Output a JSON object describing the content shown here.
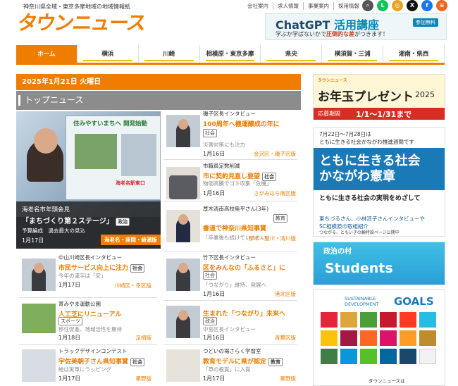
{
  "header": {
    "tagline": "神奈川県全域・東京多摩地域の地域情報紙",
    "logo": "タウンニュース",
    "logo_mark": "®",
    "top_links": [
      "会社案内",
      "求人情報",
      "事業案内",
      "採用情報"
    ]
  },
  "top_ad": {
    "title_a": "ChatGPT",
    "title_b": "活用講座",
    "badge": "参加無料",
    "subtitle_a": "学ぶか学ばないかで",
    "subtitle_b": "圧倒的な差",
    "subtitle_c": "がつきます！"
  },
  "nav": {
    "items": [
      "ホーム",
      "横浜",
      "川崎",
      "相模原・東京多摩",
      "県央",
      "横須賀・三浦",
      "湘南・県西"
    ]
  },
  "date_bar": "2025年1月21日 火曜日",
  "section_title": "トップニュース",
  "hero": {
    "board_title": "住みやすいまちへ 開発始動",
    "board_note": "海老名駅東口",
    "category": "海老名市年頭会見",
    "title": "「まちづくり第２ステージ」",
    "tag": "政治",
    "summary": "予算編成　過去最大の見込",
    "date": "1月17日",
    "area": "海老名・座間・綾瀬版"
  },
  "news_items": [
    {
      "category": "磯子区長インタビュー",
      "title": "100周年へ機運醸成の年に",
      "tag": "社会",
      "summary": "災害対策にも注力",
      "date": "1月16日",
      "area": "金沢区・磯子区版"
    },
    {
      "category": "市職員定数削減",
      "title": "市に契約見直し要望",
      "tag": "社会",
      "summary": "物価高騰でゴミ収集「危機」",
      "date": "1月16日",
      "area": "さがみはら南区版"
    },
    {
      "category": "厚木清南高校奥平さん(3年)",
      "title": "書道で神奈川県知事賞",
      "tag": "教育",
      "summary": "「卒業後も続けていきたい」",
      "date": "1月16日",
      "area": "厚木・愛川・清川版"
    },
    {
      "category": "中山川崎区長インタビュー",
      "title": "市民サービス向上に注力",
      "tag": "社会",
      "summary": "今年の漢字は「安」",
      "date": "1月17日",
      "area": "川崎区・幸区版"
    },
    {
      "category": "竹下区長インタビュー",
      "title": "区をみんなの「ふるさと」に",
      "tag": "社会",
      "summary": "「つながり」維持、発展へ",
      "date": "1月16日",
      "area": "港北区版"
    },
    {
      "category": "寄みやま運動公園",
      "title": "人工芝にリニューアル",
      "tag": "スポーツ",
      "summary": "移住促進、地域活性を期待",
      "date": "1月18日",
      "area": "足柄版"
    },
    {
      "category": "",
      "title": "生まれた「つながり」未来へ",
      "tag": "政治",
      "summary": "中島区長インタビュー",
      "date": "1月16日",
      "area": "青葉区版"
    },
    {
      "category": "トラックデザインコンテスト",
      "title": "宇佐美朝子さん県知事賞",
      "tag": "社会",
      "summary": "絵は実車にラッピング",
      "date": "1月17日",
      "area": "秦野版"
    },
    {
      "category": "つどいの場さらく学習室",
      "title": "教育モデルに県が認定",
      "tag": "教育",
      "summary": "「草の根賞」に入賞",
      "date": "1月17日",
      "area": "秦野版"
    }
  ],
  "sidebar": {
    "ad1": {
      "mini": "タウンニュース",
      "title": "お年玉プレゼント",
      "year": "2025",
      "label": "応募期間",
      "period": "1/1〜1/31まで"
    },
    "ad2": {
      "top_a": "7月22日〜7月28日は",
      "top_b": "ともに生きる社会かながわ推進週間です",
      "title_a": "ともに生きる社会",
      "title_b": "かながわ憲章",
      "mid_a": "ともに生きる社会の実現をめざして",
      "mid_b": "",
      "small_a": "東ちづるさん、小林凉子さんインタビューや",
      "small_b": "SC相模原の取組紹介",
      "foot": "つながる、ともいきの輪特設ページ公開中"
    },
    "ad3": {
      "title": "政治の村",
      "big": "Students"
    },
    "ad4": {
      "title_a": "SUSTAINABLE",
      "title_b": "DEVELOPMENT",
      "goals": "GOALS",
      "foot": "タウンニュースは"
    }
  },
  "colors": {
    "accent": "#ef7d00",
    "nav_underline": "#e6c200",
    "gray_header": "#8c8c8c"
  },
  "icons": [
    "search-icon",
    "line-icon",
    "instagram-icon",
    "x-icon",
    "facebook-icon",
    "rss-icon"
  ]
}
